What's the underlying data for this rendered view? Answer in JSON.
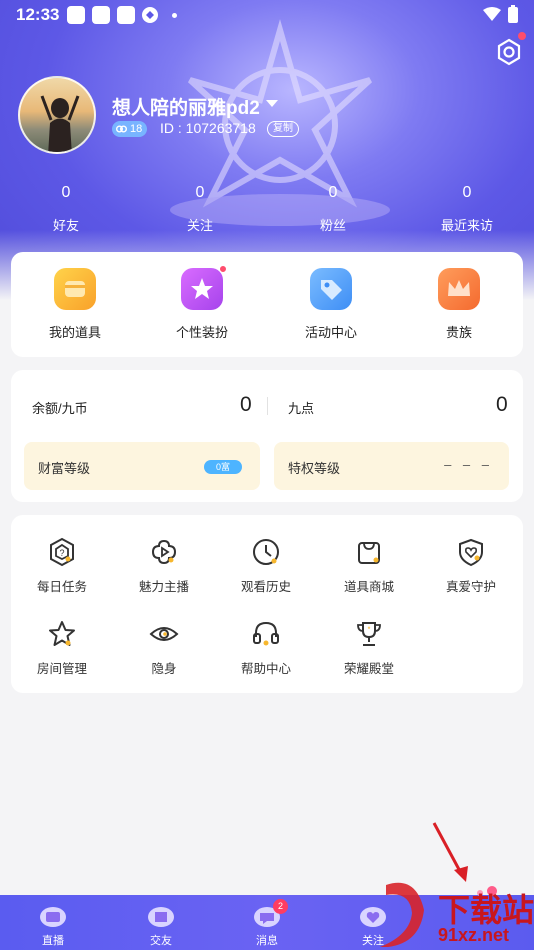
{
  "status_bar": {
    "time": "12:33"
  },
  "profile": {
    "username": "想人陪的丽雅pd2",
    "level": "18",
    "uid": "ID : 107263718",
    "copy_label": "复制"
  },
  "stats": [
    {
      "count": "0",
      "label": "好友"
    },
    {
      "count": "0",
      "label": "关注"
    },
    {
      "count": "0",
      "label": "粉丝"
    },
    {
      "count": "0",
      "label": "最近来访"
    }
  ],
  "features": [
    {
      "label": "我的道具",
      "icon": "props-box-icon",
      "color": "#f9b62d"
    },
    {
      "label": "个性装扮",
      "icon": "dress-up-icon",
      "color": "#c054f2"
    },
    {
      "label": "活动中心",
      "icon": "event-tag-icon",
      "color": "#5aa6f8"
    },
    {
      "label": "贵族",
      "icon": "crown-icon",
      "color": "#f7853f"
    }
  ],
  "wallet": {
    "balance_label": "余额/九币",
    "balance_value": "0",
    "points_label": "九点",
    "points_value": "0",
    "wealth_label": "财富等级",
    "wealth_badge": "0富",
    "privilege_label": "特权等级",
    "privilege_value": "– – –"
  },
  "tools": [
    {
      "label": "每日任务",
      "icon": "daily-task-icon"
    },
    {
      "label": "魅力主播",
      "icon": "charm-anchor-icon"
    },
    {
      "label": "观看历史",
      "icon": "history-clock-icon"
    },
    {
      "label": "道具商城",
      "icon": "shop-bag-icon"
    },
    {
      "label": "真爱守护",
      "icon": "heart-shield-icon"
    },
    {
      "label": "房间管理",
      "icon": "star-room-icon"
    },
    {
      "label": "隐身",
      "icon": "eye-icon"
    },
    {
      "label": "帮助中心",
      "icon": "headset-icon"
    },
    {
      "label": "荣耀殿堂",
      "icon": "trophy-icon"
    }
  ],
  "tabbar": [
    {
      "label": "直播"
    },
    {
      "label": "交友"
    },
    {
      "label": "消息",
      "badge": "2"
    },
    {
      "label": "关注"
    }
  ],
  "watermark": {
    "text_cn": "下载站",
    "text_url": "91xz.net"
  }
}
